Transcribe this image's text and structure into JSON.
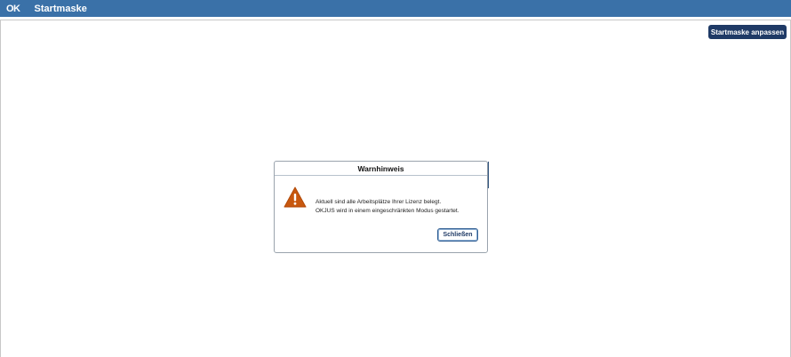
{
  "titlebar": {
    "logo_text": "OK",
    "title": "Startmaske"
  },
  "toolbar": {
    "customize_label": "Startmaske anpassen"
  },
  "dialog": {
    "title": "Warnhinweis",
    "icon": "warning-triangle-icon",
    "message_line1": "Aktuell sind alle Arbeitsplätze Ihrer Lizenz belegt.",
    "message_line2": "OKJUS wird in einem eingeschränkten Modus gestartet.",
    "close_label": "Schließen"
  },
  "colors": {
    "titlebar": "#3a71a8",
    "primary_button": "#1f3a66",
    "warning": "#c8580f"
  }
}
